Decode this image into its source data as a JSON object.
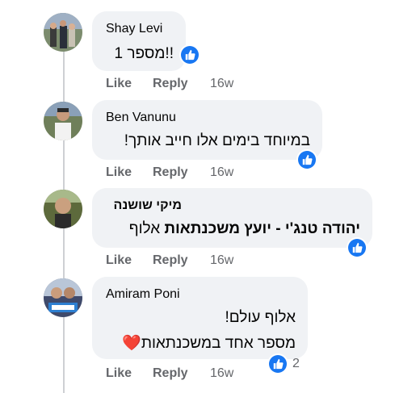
{
  "comments": [
    {
      "author": "Shay Levi",
      "lines": [
        "!!מספר 1"
      ],
      "actions": {
        "like": "Like",
        "reply": "Reply",
        "time": "16w"
      }
    },
    {
      "author": "Ben Vanunu",
      "lines": [
        "במיוחד בימים אלו חייב אותך!"
      ],
      "actions": {
        "like": "Like",
        "reply": "Reply",
        "time": "16w"
      }
    },
    {
      "author": "מיקי שושנה",
      "mention": "יהודה טנג'י - יועץ משכנתאות",
      "text_after_mention": "אלוף",
      "actions": {
        "like": "Like",
        "reply": "Reply",
        "time": "16w"
      }
    },
    {
      "author": "Amiram Poni",
      "lines": [
        "אלוף עולם!",
        "מספר אחד במשכנתאות"
      ],
      "heart_emoji": "❤️",
      "reaction_count": "2",
      "actions": {
        "like": "Like",
        "reply": "Reply",
        "time": "16w"
      }
    }
  ],
  "icons": {
    "like_reaction": "thumbs-up-icon",
    "heart": "red-heart-emoji"
  },
  "colors": {
    "bubble": "#f0f2f5",
    "like_blue": "#1877f2",
    "muted_text": "#65676b",
    "heart_red": "#e41e3f"
  }
}
